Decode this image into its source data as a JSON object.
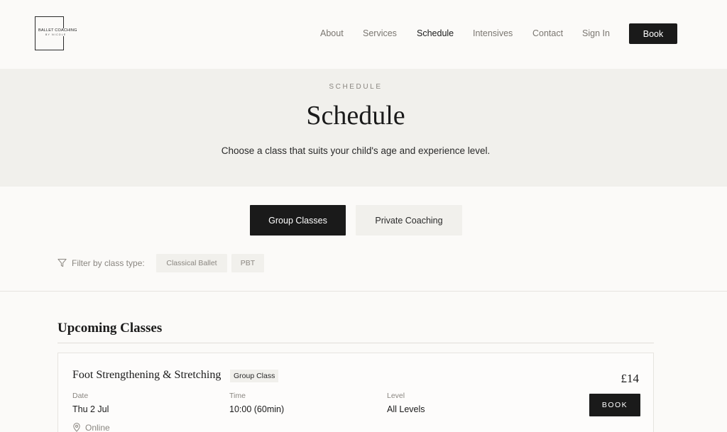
{
  "header": {
    "logo_text": "BALLET COACHING",
    "logo_sub": "BY NICOLE",
    "nav": [
      {
        "label": "About",
        "active": false
      },
      {
        "label": "Services",
        "active": false
      },
      {
        "label": "Schedule",
        "active": true
      },
      {
        "label": "Intensives",
        "active": false
      },
      {
        "label": "Contact",
        "active": false
      },
      {
        "label": "Sign In",
        "active": false
      }
    ],
    "book_label": "Book"
  },
  "hero": {
    "eyebrow": "SCHEDULE",
    "title": "Schedule",
    "subtitle": "Choose a class that suits your child's age and experience level."
  },
  "tabs": [
    {
      "label": "Group Classes",
      "selected": true
    },
    {
      "label": "Private Coaching",
      "selected": false
    }
  ],
  "filter": {
    "icon": "filter-icon",
    "label": "Filter by class type:",
    "chips": [
      "Classical Ballet",
      "PBT"
    ]
  },
  "upcoming": {
    "title": "Upcoming Classes",
    "classes": [
      {
        "title": "Foot Strengthening & Stretching",
        "badge": "Group Class",
        "price": "£14",
        "date_label": "Date",
        "date": "Thu 2 Jul",
        "time_label": "Time",
        "time": "10:00 (60min)",
        "level_label": "Level",
        "level": "All Levels",
        "location": "Online",
        "location_icon": "map-pin-icon",
        "book_label": "BOOK"
      }
    ]
  },
  "colors": {
    "background": "#fbfaf8",
    "hero_background": "#f1f0ec",
    "primary": "#1a1a1a",
    "muted_text": "#8a8680"
  }
}
